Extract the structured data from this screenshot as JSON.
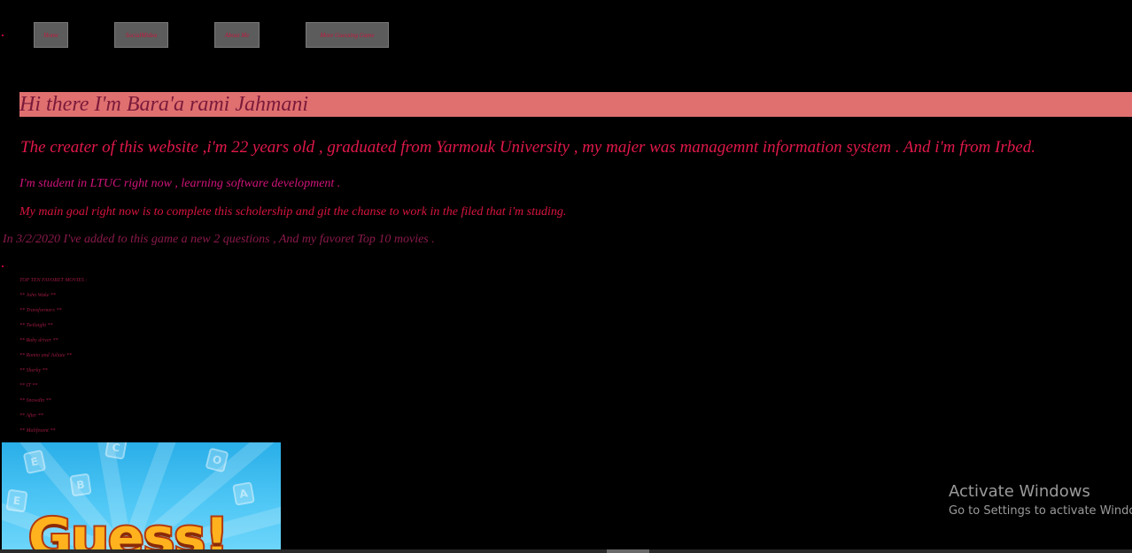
{
  "nav": {
    "items": [
      {
        "label": "Home"
      },
      {
        "label": "SocialMidea"
      },
      {
        "label": "About Me"
      },
      {
        "label": "More Guessing Game"
      }
    ]
  },
  "hero": {
    "title": "Hi there I'm Bara'a rami Jahmani"
  },
  "about": {
    "intro": "The creater of this website ,i'm 22 years old , graduated from Yarmouk University , my majer was managemnt information system . And i'm from Irbed.",
    "student": "I'm student in LTUC right now , learning software development .",
    "goal": "My main goal right now is to complete this scholership and git the chanse to work in the filed that i'm studing.",
    "update": "In 3/2/2020 I've added to this game a new 2 questions , And my favoret Top 10 movies ."
  },
  "movies": {
    "heading": "TOP TEN FAVORET MOVIES :",
    "items": [
      "** John Wake **",
      "** Transformers **",
      "** Twilaight **",
      "** Baby driver **",
      "** Romio and Juliate **",
      "** Sharky **",
      "** IT **",
      "** Snowdin **",
      "** After **",
      "** Malifesent **"
    ]
  },
  "image": {
    "text": "Guess!"
  },
  "watermark": {
    "title": "Activate Windows",
    "subtitle": "Go to Settings to activate Windows."
  },
  "colors": {
    "background": "#000000",
    "nav_button": "#5c5c5c",
    "hero_bar": "#e07070",
    "accent_text": "#e0184a"
  }
}
